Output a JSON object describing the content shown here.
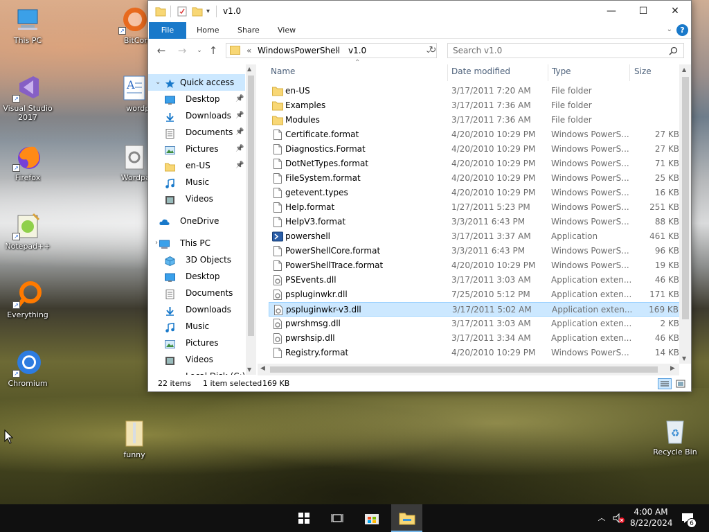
{
  "desktop": {
    "icons": [
      {
        "label": "This PC"
      },
      {
        "label": "BitComet"
      },
      {
        "label": "Visual Studio 2017"
      },
      {
        "label": "wordpad"
      },
      {
        "label": "Firefox"
      },
      {
        "label": "WordpadF"
      },
      {
        "label": "Notepad++"
      },
      {
        "label": "Everything"
      },
      {
        "label": "Chromium"
      },
      {
        "label": "funny"
      },
      {
        "label": "Recycle Bin"
      }
    ]
  },
  "window": {
    "title": "v1.0",
    "tabs": [
      "File",
      "Home",
      "Share",
      "View"
    ],
    "help": "?",
    "address": {
      "overflow": "«",
      "segments": [
        "WindowsPowerShell",
        "v1.0"
      ]
    },
    "search_placeholder": "Search v1.0",
    "columns": {
      "name": "Name",
      "date": "Date modified",
      "type": "Type",
      "size": "Size"
    },
    "nav": [
      {
        "label": "Quick access",
        "icon": "star-icon",
        "selected": true,
        "pinned": false
      },
      {
        "label": "Desktop",
        "icon": "desktop-icon",
        "pinned": true
      },
      {
        "label": "Downloads",
        "icon": "download-icon",
        "pinned": true
      },
      {
        "label": "Documents",
        "icon": "documents-icon",
        "pinned": true
      },
      {
        "label": "Pictures",
        "icon": "pictures-icon",
        "pinned": true
      },
      {
        "label": "en-US",
        "icon": "folder-icon",
        "pinned": true
      },
      {
        "label": "Music",
        "icon": "music-icon",
        "pinned": false
      },
      {
        "label": "Videos",
        "icon": "videos-icon",
        "pinned": false
      },
      {
        "label": "OneDrive",
        "icon": "cloud-icon",
        "pinned": false
      },
      {
        "label": "This PC",
        "icon": "computer-icon",
        "pinned": false
      },
      {
        "label": "3D Objects",
        "icon": "cube-icon",
        "pinned": false
      },
      {
        "label": "Desktop",
        "icon": "desktop-icon",
        "pinned": false
      },
      {
        "label": "Documents",
        "icon": "documents-icon",
        "pinned": false
      },
      {
        "label": "Downloads",
        "icon": "download-icon",
        "pinned": false
      },
      {
        "label": "Music",
        "icon": "music-icon",
        "pinned": false
      },
      {
        "label": "Pictures",
        "icon": "pictures-icon",
        "pinned": false
      },
      {
        "label": "Videos",
        "icon": "videos-icon",
        "pinned": false
      },
      {
        "label": "Local Disk (C:)",
        "icon": "disk-icon",
        "pinned": false
      }
    ],
    "files": [
      {
        "name": "en-US",
        "date": "3/17/2011 7:20 AM",
        "type": "File folder",
        "size": "",
        "icon": "folder"
      },
      {
        "name": "Examples",
        "date": "3/17/2011 7:36 AM",
        "type": "File folder",
        "size": "",
        "icon": "folder"
      },
      {
        "name": "Modules",
        "date": "3/17/2011 7:36 AM",
        "type": "File folder",
        "size": "",
        "icon": "folder"
      },
      {
        "name": "Certificate.format",
        "date": "4/20/2010 10:29 PM",
        "type": "Windows PowerS...",
        "size": "27 KB",
        "icon": "file"
      },
      {
        "name": "Diagnostics.Format",
        "date": "4/20/2010 10:29 PM",
        "type": "Windows PowerS...",
        "size": "27 KB",
        "icon": "file"
      },
      {
        "name": "DotNetTypes.format",
        "date": "4/20/2010 10:29 PM",
        "type": "Windows PowerS...",
        "size": "71 KB",
        "icon": "file"
      },
      {
        "name": "FileSystem.format",
        "date": "4/20/2010 10:29 PM",
        "type": "Windows PowerS...",
        "size": "25 KB",
        "icon": "file"
      },
      {
        "name": "getevent.types",
        "date": "4/20/2010 10:29 PM",
        "type": "Windows PowerS...",
        "size": "16 KB",
        "icon": "file"
      },
      {
        "name": "Help.format",
        "date": "1/27/2011 5:23 PM",
        "type": "Windows PowerS...",
        "size": "251 KB",
        "icon": "file"
      },
      {
        "name": "HelpV3.format",
        "date": "3/3/2011 6:43 PM",
        "type": "Windows PowerS...",
        "size": "88 KB",
        "icon": "file"
      },
      {
        "name": "powershell",
        "date": "3/17/2011 3:37 AM",
        "type": "Application",
        "size": "461 KB",
        "icon": "app"
      },
      {
        "name": "PowerShellCore.format",
        "date": "3/3/2011 6:43 PM",
        "type": "Windows PowerS...",
        "size": "96 KB",
        "icon": "file"
      },
      {
        "name": "PowerShellTrace.format",
        "date": "4/20/2010 10:29 PM",
        "type": "Windows PowerS...",
        "size": "19 KB",
        "icon": "file"
      },
      {
        "name": "PSEvents.dll",
        "date": "3/17/2011 3:03 AM",
        "type": "Application exten...",
        "size": "46 KB",
        "icon": "dll"
      },
      {
        "name": "pspluginwkr.dll",
        "date": "7/25/2010 5:12 PM",
        "type": "Application exten...",
        "size": "171 KB",
        "icon": "dll"
      },
      {
        "name": "pspluginwkr-v3.dll",
        "date": "3/17/2011 5:02 AM",
        "type": "Application exten...",
        "size": "169 KB",
        "icon": "dll",
        "selected": true
      },
      {
        "name": "pwrshmsg.dll",
        "date": "3/17/2011 3:03 AM",
        "type": "Application exten...",
        "size": "2 KB",
        "icon": "dll"
      },
      {
        "name": "pwrshsip.dll",
        "date": "3/17/2011 3:34 AM",
        "type": "Application exten...",
        "size": "46 KB",
        "icon": "dll"
      },
      {
        "name": "Registry.format",
        "date": "4/20/2010 10:29 PM",
        "type": "Windows PowerS...",
        "size": "14 KB",
        "icon": "file"
      }
    ],
    "status": {
      "items": "22 items",
      "selected": "1 item selected",
      "size": "169 KB"
    }
  },
  "taskbar": {
    "time": "4:00 AM",
    "date": "8/22/2024",
    "notifications": "6"
  },
  "colors": {
    "accent": "#1979ca",
    "selection": "#cce8ff",
    "taskbar": "#101010"
  }
}
